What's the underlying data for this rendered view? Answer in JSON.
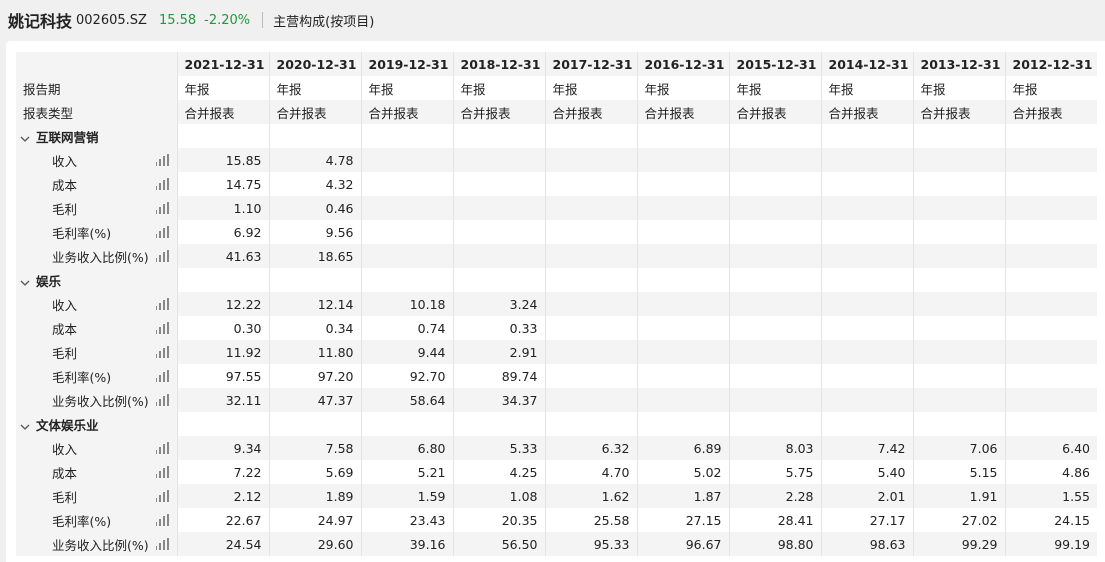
{
  "header": {
    "company": "姚记科技",
    "code": "002605.SZ",
    "price": "15.58",
    "change": "-2.20%",
    "section": "主营构成(按项目)"
  },
  "colors": {
    "down": "#1e9a3a",
    "band": "#f4f4f4"
  },
  "columns": [
    "2021-12-31",
    "2020-12-31",
    "2019-12-31",
    "2018-12-31",
    "2017-12-31",
    "2016-12-31",
    "2015-12-31",
    "2014-12-31",
    "2013-12-31",
    "2012-12-31"
  ],
  "meta_rows": [
    {
      "label": "报告期",
      "values": [
        "年报",
        "年报",
        "年报",
        "年报",
        "年报",
        "年报",
        "年报",
        "年报",
        "年报",
        "年报"
      ]
    },
    {
      "label": "报表类型",
      "values": [
        "合并报表",
        "合并报表",
        "合并报表",
        "合并报表",
        "合并报表",
        "合并报表",
        "合并报表",
        "合并报表",
        "合并报表",
        "合并报表"
      ]
    }
  ],
  "groups": [
    {
      "name": "互联网营销",
      "rows": [
        {
          "label": "收入",
          "values": [
            "15.85",
            "4.78",
            "",
            "",
            "",
            "",
            "",
            "",
            "",
            ""
          ]
        },
        {
          "label": "成本",
          "values": [
            "14.75",
            "4.32",
            "",
            "",
            "",
            "",
            "",
            "",
            "",
            ""
          ]
        },
        {
          "label": "毛利",
          "values": [
            "1.10",
            "0.46",
            "",
            "",
            "",
            "",
            "",
            "",
            "",
            ""
          ]
        },
        {
          "label": "毛利率(%)",
          "values": [
            "6.92",
            "9.56",
            "",
            "",
            "",
            "",
            "",
            "",
            "",
            ""
          ]
        },
        {
          "label": "业务收入比例(%)",
          "values": [
            "41.63",
            "18.65",
            "",
            "",
            "",
            "",
            "",
            "",
            "",
            ""
          ]
        }
      ]
    },
    {
      "name": "娱乐",
      "rows": [
        {
          "label": "收入",
          "values": [
            "12.22",
            "12.14",
            "10.18",
            "3.24",
            "",
            "",
            "",
            "",
            "",
            ""
          ]
        },
        {
          "label": "成本",
          "values": [
            "0.30",
            "0.34",
            "0.74",
            "0.33",
            "",
            "",
            "",
            "",
            "",
            ""
          ]
        },
        {
          "label": "毛利",
          "values": [
            "11.92",
            "11.80",
            "9.44",
            "2.91",
            "",
            "",
            "",
            "",
            "",
            ""
          ]
        },
        {
          "label": "毛利率(%)",
          "values": [
            "97.55",
            "97.20",
            "92.70",
            "89.74",
            "",
            "",
            "",
            "",
            "",
            ""
          ]
        },
        {
          "label": "业务收入比例(%)",
          "values": [
            "32.11",
            "47.37",
            "58.64",
            "34.37",
            "",
            "",
            "",
            "",
            "",
            ""
          ]
        }
      ]
    },
    {
      "name": "文体娱乐业",
      "rows": [
        {
          "label": "收入",
          "values": [
            "9.34",
            "7.58",
            "6.80",
            "5.33",
            "6.32",
            "6.89",
            "8.03",
            "7.42",
            "7.06",
            "6.40"
          ]
        },
        {
          "label": "成本",
          "values": [
            "7.22",
            "5.69",
            "5.21",
            "4.25",
            "4.70",
            "5.02",
            "5.75",
            "5.40",
            "5.15",
            "4.86"
          ]
        },
        {
          "label": "毛利",
          "values": [
            "2.12",
            "1.89",
            "1.59",
            "1.08",
            "1.62",
            "1.87",
            "2.28",
            "2.01",
            "1.91",
            "1.55"
          ]
        },
        {
          "label": "毛利率(%)",
          "values": [
            "22.67",
            "24.97",
            "23.43",
            "20.35",
            "25.58",
            "27.15",
            "28.41",
            "27.17",
            "27.02",
            "24.15"
          ]
        },
        {
          "label": "业务收入比例(%)",
          "values": [
            "24.54",
            "29.60",
            "39.16",
            "56.50",
            "95.33",
            "96.67",
            "98.80",
            "98.63",
            "99.29",
            "99.19"
          ]
        }
      ]
    }
  ],
  "icons": {
    "expand": "chevron-down-icon",
    "chart": "bar-chart-icon"
  }
}
